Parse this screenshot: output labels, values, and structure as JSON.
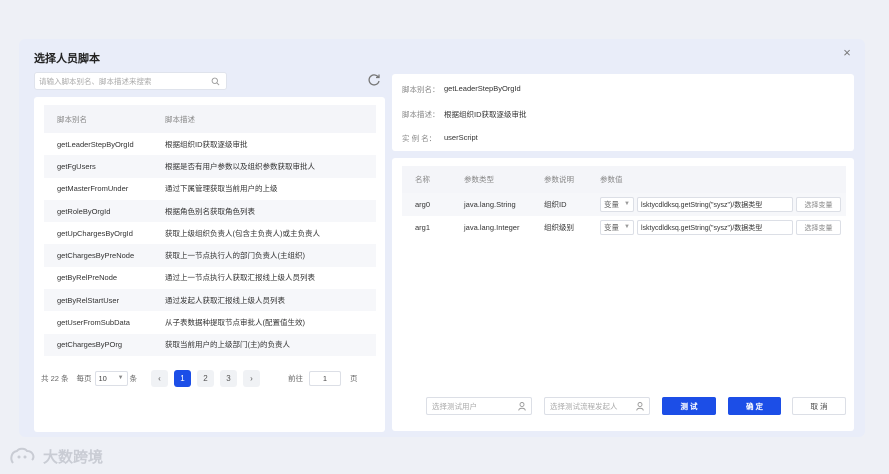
{
  "dialog": {
    "title": "选择人员脚本",
    "close_label": "×"
  },
  "search": {
    "placeholder": "请输入脚本别名、脚本描述来搜索"
  },
  "script_table": {
    "headers": [
      "脚本别名",
      "脚本描述"
    ],
    "rows": [
      {
        "alias": "getLeaderStepByOrgId",
        "desc": "根据组织ID获取逐级审批"
      },
      {
        "alias": "getFgUsers",
        "desc": "根据是否有用户参数以及组织参数获取审批人"
      },
      {
        "alias": "getMasterFromUnder",
        "desc": "通过下属管理获取当前用户的上级"
      },
      {
        "alias": "getRoleByOrgId",
        "desc": "根据角色别名获取角色列表"
      },
      {
        "alias": "getUpChargesByOrgId",
        "desc": "获取上级组织负责人(包含主负责人)或主负责人"
      },
      {
        "alias": "getChargesByPreNode",
        "desc": "获取上一节点执行人的部门负责人(主组织)"
      },
      {
        "alias": "getByRelPreNode",
        "desc": "通过上一节点执行人获取汇报线上级人员列表"
      },
      {
        "alias": "getByRelStartUser",
        "desc": "通过发起人获取汇报线上级人员列表"
      },
      {
        "alias": "getUserFromSubData",
        "desc": "从子表数据种提取节点审批人(配置值生效)"
      },
      {
        "alias": "getChargesByPOrg",
        "desc": "获取当前用户的上级部门(主)的负责人"
      }
    ]
  },
  "pager": {
    "total": "共 22 条",
    "size_label": "每页",
    "page_size": "10",
    "size_unit": "条",
    "prev": "‹",
    "pages": [
      "1",
      "2",
      "3"
    ],
    "next": "›",
    "goto_label": "前往",
    "goto_value": "1",
    "page_unit": "页"
  },
  "info": {
    "alias_label": "脚本别名：",
    "alias_value": "getLeaderStepByOrgId",
    "desc_label": "脚本描述：",
    "desc_value": "根据组织ID获取逐级审批",
    "instance_label": "实 例 名：",
    "instance_value": "userScript"
  },
  "args_table": {
    "headers": [
      "名称",
      "参数类型",
      "参数说明",
      "参数值"
    ],
    "rows": [
      {
        "name": "arg0",
        "type": "java.lang.String",
        "desc": "组织ID",
        "var_type": "变量",
        "value": "lsktycdldksq.getString(\"sysz\")/数据类型",
        "choose_label": "选择变量"
      },
      {
        "name": "arg1",
        "type": "java.lang.Integer",
        "desc": "组织级别",
        "var_type": "变量",
        "value": "lsktycdldksq.getString(\"sysz\")/数据类型",
        "choose_label": "选择变量"
      }
    ]
  },
  "footer": {
    "test_user_placeholder": "选择测试用户",
    "test_starter_placeholder": "选择测试流程发起人",
    "test_label": "测 试",
    "ok_label": "确 定",
    "cancel_label": "取 消"
  },
  "watermark": {
    "text": "大数跨境"
  },
  "colors": {
    "primary": "#1c4ee7",
    "dialog_bg": "#e9edf9"
  }
}
